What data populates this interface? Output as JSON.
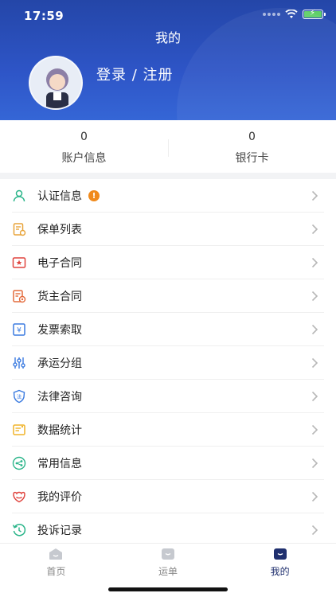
{
  "status_bar": {
    "time": "17:59"
  },
  "header": {
    "title": "我的",
    "login_label": "登录 / 注册"
  },
  "stats": [
    {
      "value": "0",
      "label": "账户信息"
    },
    {
      "value": "0",
      "label": "银行卡"
    }
  ],
  "menu": {
    "items": [
      {
        "label": "认证信息",
        "icon": "user-check-icon",
        "badge": "!"
      },
      {
        "label": "保单列表",
        "icon": "policy-list-icon"
      },
      {
        "label": "电子合同",
        "icon": "e-contract-icon"
      },
      {
        "label": "货主合同",
        "icon": "shipper-contract-icon"
      },
      {
        "label": "发票索取",
        "icon": "invoice-icon"
      },
      {
        "label": "承运分组",
        "icon": "group-sliders-icon"
      },
      {
        "label": "法律咨询",
        "icon": "legal-shield-icon"
      },
      {
        "label": "数据统计",
        "icon": "statistics-icon"
      },
      {
        "label": "常用信息",
        "icon": "share-nodes-icon"
      },
      {
        "label": "我的评价",
        "icon": "rating-icon"
      },
      {
        "label": "投诉记录",
        "icon": "complaint-history-icon"
      }
    ]
  },
  "tabbar": {
    "tabs": [
      {
        "label": "首页",
        "icon": "home-tab-icon",
        "active": false
      },
      {
        "label": "运单",
        "icon": "waybill-tab-icon",
        "active": false
      },
      {
        "label": "我的",
        "icon": "profile-tab-icon",
        "active": true
      }
    ]
  },
  "colors": {
    "header": "#2a4fbd",
    "active_tab": "#1f2f6e",
    "badge": "#f08a1c"
  }
}
